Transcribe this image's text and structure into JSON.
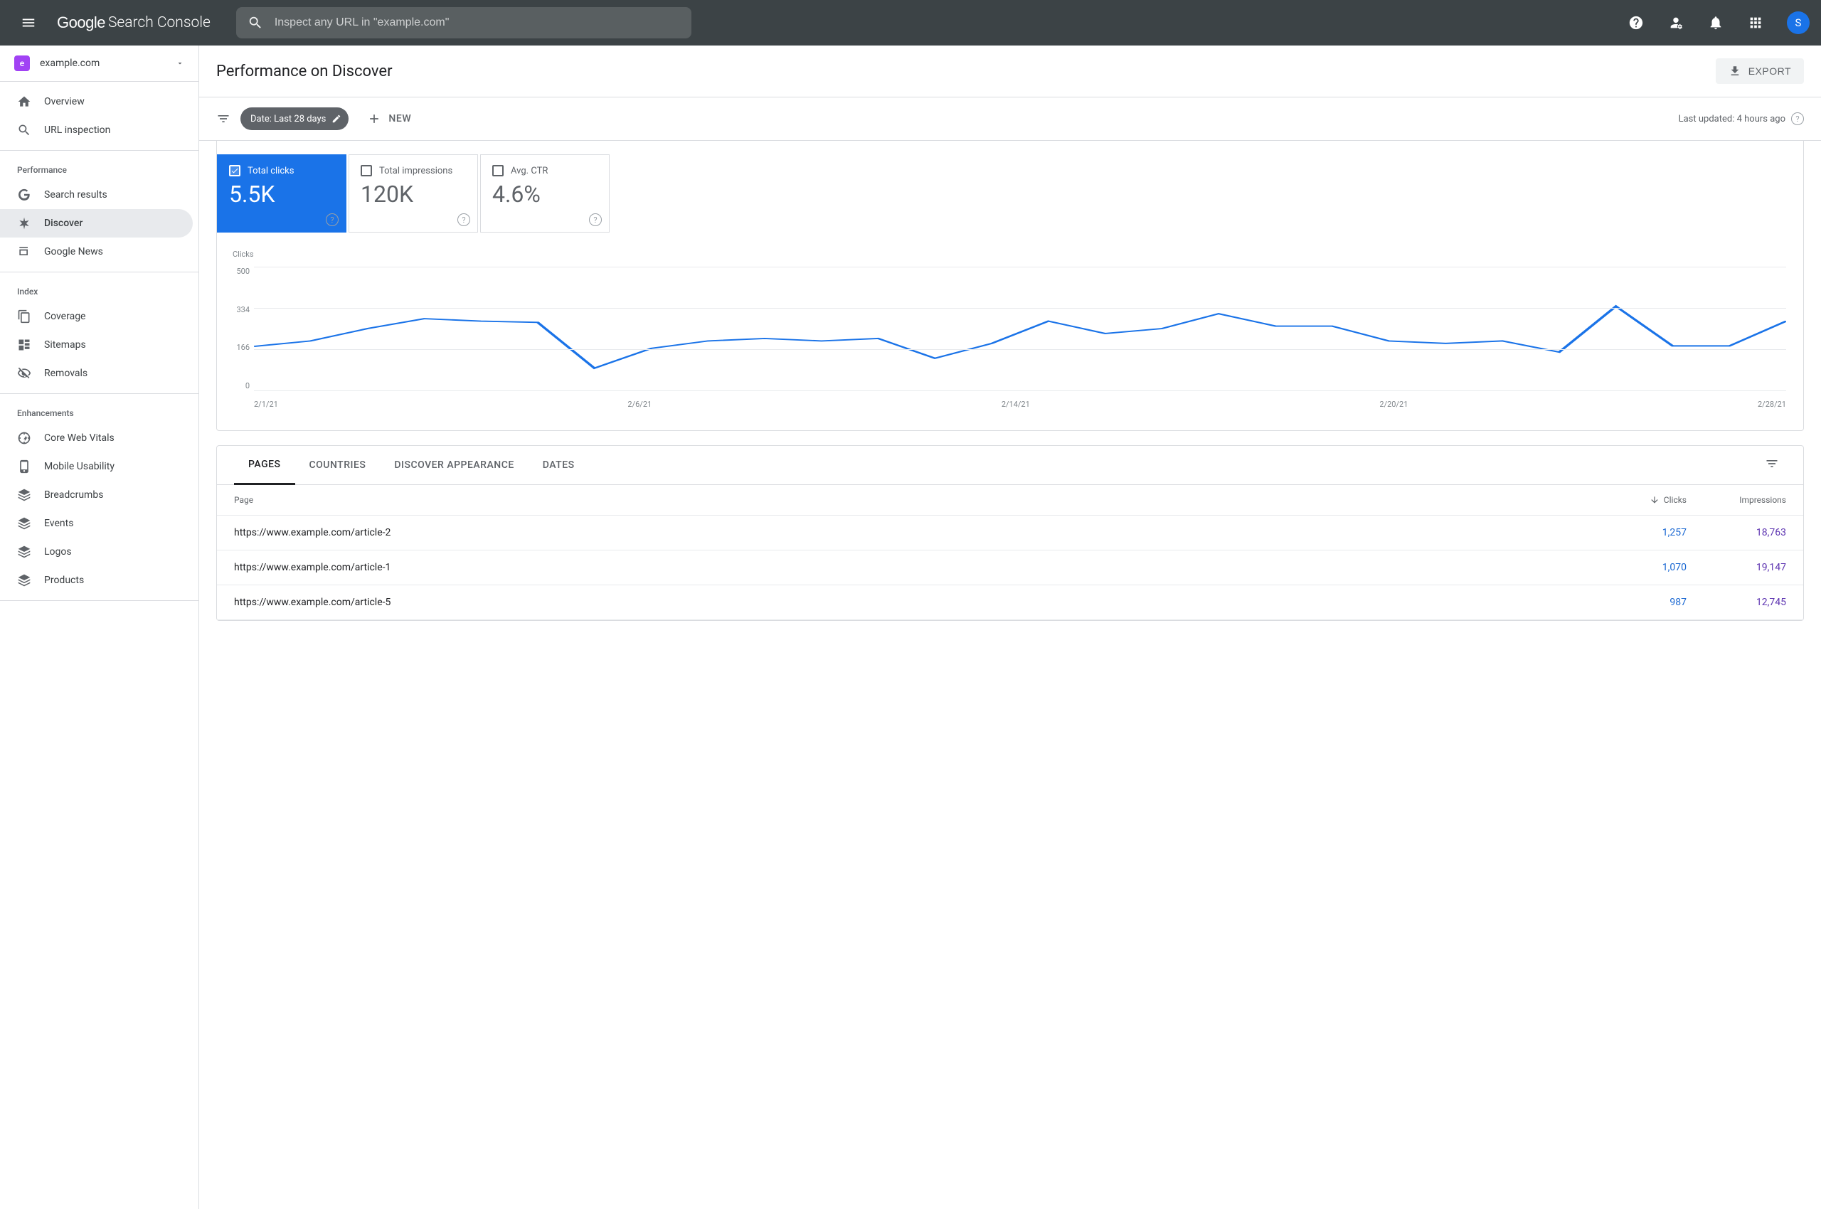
{
  "header": {
    "logo_google": "Google",
    "logo_product": "Search Console",
    "search_placeholder": "Inspect any URL in \"example.com\"",
    "avatar_letter": "S"
  },
  "property": {
    "name": "example.com",
    "icon_letter": "e"
  },
  "sidebar": {
    "top": [
      {
        "label": "Overview",
        "icon": "home"
      },
      {
        "label": "URL inspection",
        "icon": "search"
      }
    ],
    "sections": [
      {
        "heading": "Performance",
        "items": [
          {
            "label": "Search results",
            "icon": "google"
          },
          {
            "label": "Discover",
            "icon": "asterisk",
            "selected": true
          },
          {
            "label": "Google News",
            "icon": "news"
          }
        ]
      },
      {
        "heading": "Index",
        "items": [
          {
            "label": "Coverage",
            "icon": "copy"
          },
          {
            "label": "Sitemaps",
            "icon": "sitemap"
          },
          {
            "label": "Removals",
            "icon": "eye-off"
          }
        ]
      },
      {
        "heading": "Enhancements",
        "items": [
          {
            "label": "Core Web Vitals",
            "icon": "speed"
          },
          {
            "label": "Mobile Usability",
            "icon": "phone"
          },
          {
            "label": "Breadcrumbs",
            "icon": "stack"
          },
          {
            "label": "Events",
            "icon": "stack"
          },
          {
            "label": "Logos",
            "icon": "stack"
          },
          {
            "label": "Products",
            "icon": "stack"
          }
        ]
      }
    ]
  },
  "page": {
    "title": "Performance on Discover",
    "export_label": "EXPORT",
    "date_chip": "Date: Last 28 days",
    "new_label": "NEW",
    "last_updated": "Last updated: 4 hours ago"
  },
  "metrics": [
    {
      "label": "Total clicks",
      "value": "5.5K",
      "active": true
    },
    {
      "label": "Total impressions",
      "value": "120K",
      "active": false
    },
    {
      "label": "Avg. CTR",
      "value": "4.6%",
      "active": false
    }
  ],
  "chart_data": {
    "type": "line",
    "title": "Clicks",
    "ylabel": "Clicks",
    "ylim": [
      0,
      500
    ],
    "yticks": [
      500,
      334,
      166,
      0
    ],
    "categories": [
      "2/1/21",
      "2/2/21",
      "2/3/21",
      "2/4/21",
      "2/5/21",
      "2/6/21",
      "2/7/21",
      "2/8/21",
      "2/9/21",
      "2/10/21",
      "2/11/21",
      "2/12/21",
      "2/13/21",
      "2/14/21",
      "2/15/21",
      "2/16/21",
      "2/17/21",
      "2/18/21",
      "2/19/21",
      "2/20/21",
      "2/21/21",
      "2/22/21",
      "2/23/21",
      "2/24/21",
      "2/25/21",
      "2/26/21",
      "2/27/21",
      "2/28/21"
    ],
    "xticks": [
      "2/1/21",
      "2/6/21",
      "2/14/21",
      "2/20/21",
      "2/28/21"
    ],
    "series": [
      {
        "name": "Clicks",
        "values": [
          178,
          200,
          250,
          290,
          280,
          275,
          90,
          170,
          200,
          210,
          200,
          210,
          130,
          190,
          280,
          230,
          250,
          310,
          260,
          260,
          200,
          190,
          200,
          155,
          340,
          180,
          180,
          280
        ]
      }
    ]
  },
  "table": {
    "tabs": [
      "PAGES",
      "COUNTRIES",
      "DISCOVER APPEARANCE",
      "DATES"
    ],
    "active_tab": 0,
    "columns": {
      "page": "Page",
      "clicks": "Clicks",
      "impressions": "Impressions"
    },
    "rows": [
      {
        "page": "https://www.example.com/article-2",
        "clicks": "1,257",
        "impressions": "18,763"
      },
      {
        "page": "https://www.example.com/article-1",
        "clicks": "1,070",
        "impressions": "19,147"
      },
      {
        "page": "https://www.example.com/article-5",
        "clicks": "987",
        "impressions": "12,745"
      }
    ]
  }
}
